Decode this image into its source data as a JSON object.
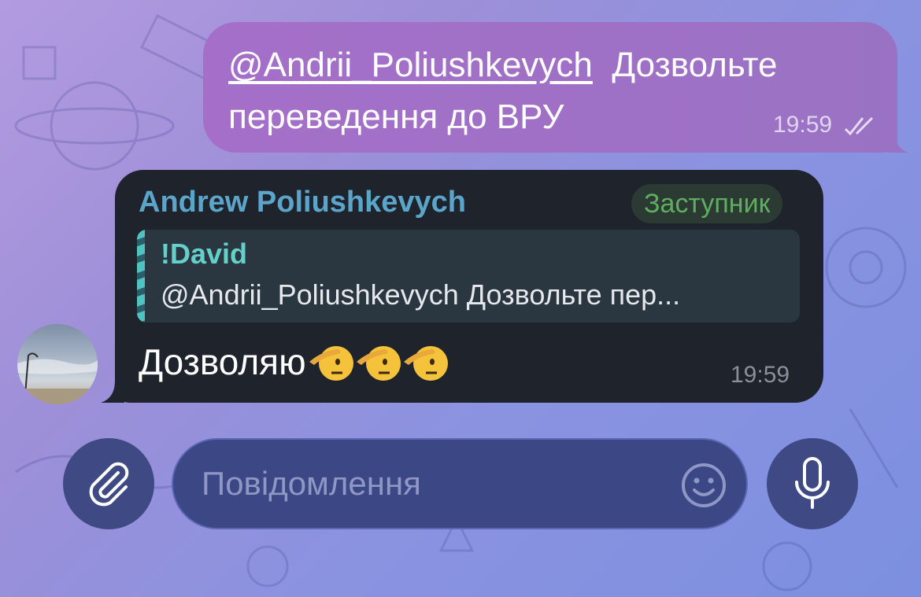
{
  "outgoing": {
    "mention": "@Andrii_Poliushkevych",
    "text": "Дозвольте переведення до ВРУ",
    "time": "19:59",
    "status_icon": "double-check-icon"
  },
  "incoming": {
    "sender": "Andrew Poliushkevych",
    "role": "Заступник",
    "reply": {
      "name": "!David",
      "text": "@Andrii_Poliushkevych Дозвольте пер..."
    },
    "text": "Дозволяю",
    "emojis": [
      "saluting-face-icon",
      "saluting-face-icon",
      "saluting-face-icon"
    ],
    "time": "19:59"
  },
  "composer": {
    "placeholder": "Повідомлення",
    "attach_icon": "paperclip-icon",
    "emoji_icon": "smiley-icon",
    "mic_icon": "microphone-icon"
  },
  "colors": {
    "outgoing_bubble": "#a56fc9",
    "incoming_bubble": "#1f232c",
    "sender_name": "#5aa5c9",
    "role_badge": "#5fae60",
    "reply_name": "#64d0c9"
  }
}
